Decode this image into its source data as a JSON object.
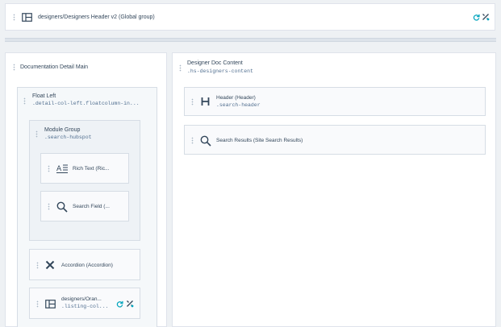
{
  "header_bar": {
    "title": "designers/Designers Header v2 (Global group)"
  },
  "left_column": {
    "title": "Documentation Detail Main",
    "float_left": {
      "title": "Float Left",
      "selector": ".detail-col-left.floatcolumn-in..."
    },
    "module_group": {
      "title": "Module Group",
      "selector": ".search-hubspot",
      "rich_text_label": "Rich Text (Ric...",
      "search_field_label": "Search Field (..."
    },
    "accordion_label": "Accordion (Accordion)",
    "orange_group": {
      "title": "designers/Oran...",
      "selector": ".listing-col..."
    }
  },
  "right_column": {
    "title": "Designer Doc Content",
    "selector": ".hs-designers-content",
    "header_module": {
      "title": "Header (Header)",
      "selector": ".search-header"
    },
    "search_results_label": "Search Results (Site Search Results)"
  },
  "colors": {
    "background": "#eef1f4",
    "panel": "#ffffff",
    "module": "#f5f8fa",
    "border": "#dfe3eb",
    "text": "#33475b",
    "global_green": "#00a4bd"
  }
}
